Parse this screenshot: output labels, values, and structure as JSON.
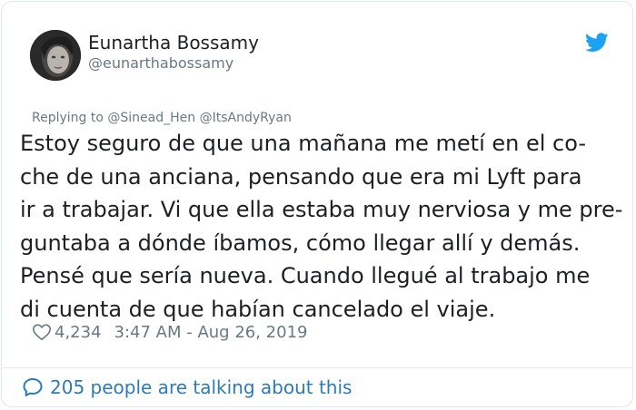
{
  "author": {
    "name": "Eunartha Bossamy",
    "handle": "@eunarthabossamy"
  },
  "icons": {
    "brand": "twitter-bird-icon",
    "like": "heart-icon",
    "conversation": "speech-bubble-icon"
  },
  "colors": {
    "brand_blue": "#1da1f2",
    "link_blue": "#2b7bb9",
    "muted_text": "#697882",
    "body_text": "#1c2022",
    "border": "#e1e8ed"
  },
  "tweet": {
    "replying_to_prefix": "Replying to",
    "replying_to": [
      "@Sinead_Hen",
      "@ItsAndyRyan"
    ],
    "text_lines": [
      "Estoy seguro de que una mañana me metí en el co-",
      "che de una anciana, pensando que era mi Lyft para",
      "ir a trabajar. Vi que ella estaba muy nerviosa y me pre-",
      "guntaba a dónde íbamos, cómo llegar allí y demás.",
      "Pensé que sería nueva. Cuando llegué al trabajo me",
      "di cuenta de que habían cancelado el viaje."
    ],
    "likes": "4,234",
    "timestamp": "3:47 AM - Aug 26, 2019"
  },
  "footer": {
    "conversation_label": "205 people are talking about this"
  }
}
